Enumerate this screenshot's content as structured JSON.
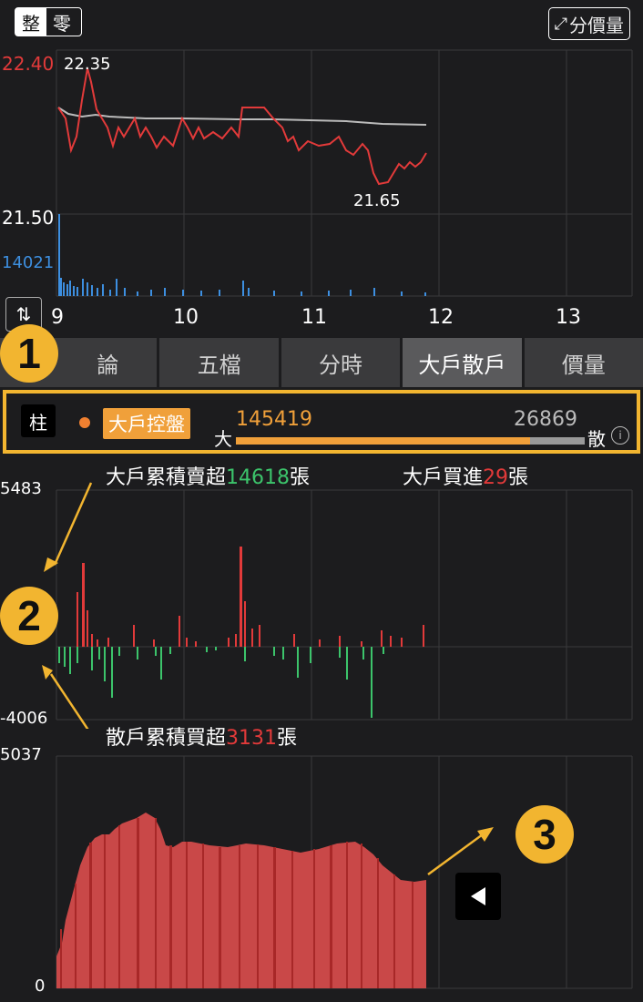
{
  "mode_toggle": {
    "left": "整",
    "right": "零"
  },
  "price_volume_button": "分價量",
  "price_chart": {
    "y_top": "22.40",
    "y_bottom": "21.50",
    "high_label": "22.35",
    "low_label": "21.65",
    "volume_max": "14021",
    "x_ticks": [
      "9",
      "10",
      "11",
      "12",
      "13"
    ]
  },
  "tabs": [
    {
      "label": "論",
      "active": false
    },
    {
      "label": "五檔",
      "active": false
    },
    {
      "label": "分時",
      "active": false
    },
    {
      "label": "大戶散戶",
      "active": true
    },
    {
      "label": "價量",
      "active": false
    }
  ],
  "control_bar": {
    "bar_icon_label": "柱",
    "chip_label": "大戶控盤",
    "big_prefix": "大",
    "big_value": "145419",
    "retail_value": "26869",
    "retail_suffix": "散",
    "info_icon": "i",
    "big_fraction": 0.844
  },
  "annotations": {
    "num1": "1",
    "num2": "2",
    "num3": "3",
    "big_sell_text": "大戶累積賣超",
    "big_sell_value": "14618",
    "big_sell_unit": "張",
    "big_buy_text": "大戶買進",
    "big_buy_value": "29",
    "big_buy_unit": "張",
    "retail_buy_text": "散戶累積買超",
    "retail_buy_value": "3131",
    "retail_buy_unit": "張"
  },
  "diff_chart": {
    "y_top": "5483",
    "y_bottom": "-4006"
  },
  "cum_chart": {
    "y_top": "5037",
    "y_bottom": "0"
  },
  "colors": {
    "accent": "#f2b530",
    "price_line": "#e23a3a",
    "avg_line": "#bbbbbb",
    "volume": "#3d8fe0",
    "positive": "#e23a3a",
    "negative": "#3cc46b"
  }
}
